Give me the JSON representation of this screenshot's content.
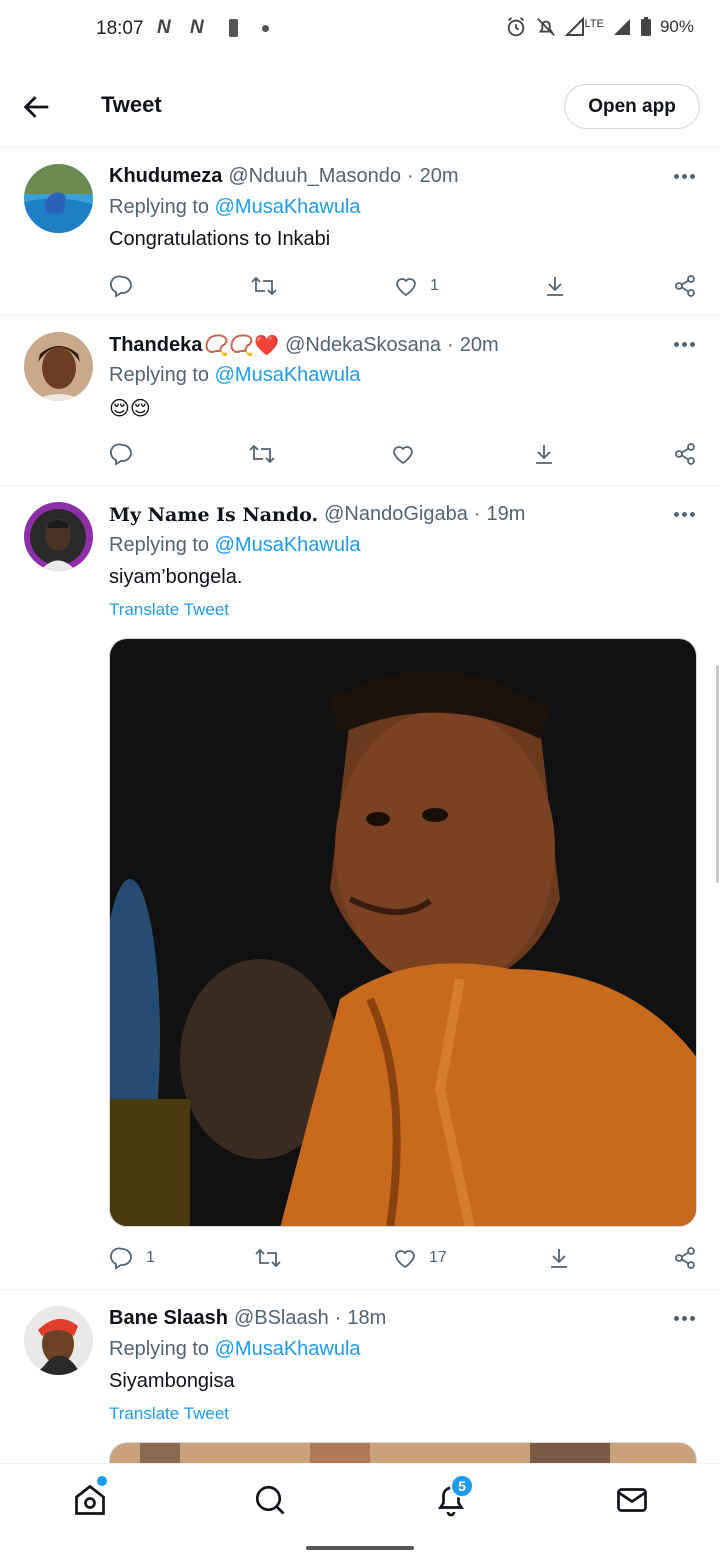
{
  "status_bar": {
    "time": "18:07",
    "net1": "N",
    "net2": "N",
    "lte": "LTE",
    "battery": "90%"
  },
  "header": {
    "title": "Tweet",
    "open_app_label": "Open app"
  },
  "tweets": [
    {
      "name": "Khudumeza",
      "handle": "@Nduuh_Masondo",
      "separator": "·",
      "time": "20m",
      "replying_prefix": "Replying to",
      "replying_to": "@MusaKhawula",
      "text": "Congratulations to Inkabi",
      "reply_count": "",
      "retweet_count": "",
      "like_count": "1"
    },
    {
      "name": "Thandeka",
      "name_emoji": "📿📿❤️",
      "handle": "@NdekaSkosana",
      "separator": "·",
      "time": "20m",
      "replying_prefix": "Replying to",
      "replying_to": "@MusaKhawula",
      "text": "😌😌",
      "reply_count": "",
      "retweet_count": "",
      "like_count": ""
    },
    {
      "name": "My Name Is Nando.",
      "handle": "@NandoGigaba",
      "separator": "·",
      "time": "19m",
      "replying_prefix": "Replying to",
      "replying_to": "@MusaKhawula",
      "text": "siyam’bongela.",
      "translate": "Translate Tweet",
      "reply_count": "1",
      "retweet_count": "",
      "like_count": "17"
    },
    {
      "name": "Bane Slaash",
      "handle": "@BSlaash",
      "separator": "·",
      "time": "18m",
      "replying_prefix": "Replying to",
      "replying_to": "@MusaKhawula",
      "text": "Siyambongisa",
      "translate": "Translate Tweet"
    }
  ],
  "bottom_nav": {
    "items": [
      "home-icon",
      "search-icon",
      "notifications-icon",
      "messages-icon"
    ],
    "notification_badge": "5"
  },
  "colors": {
    "accent": "#1d9bf0",
    "secondary_text": "#536471",
    "primary_text": "#0f1419",
    "divider": "#eff3f4"
  }
}
